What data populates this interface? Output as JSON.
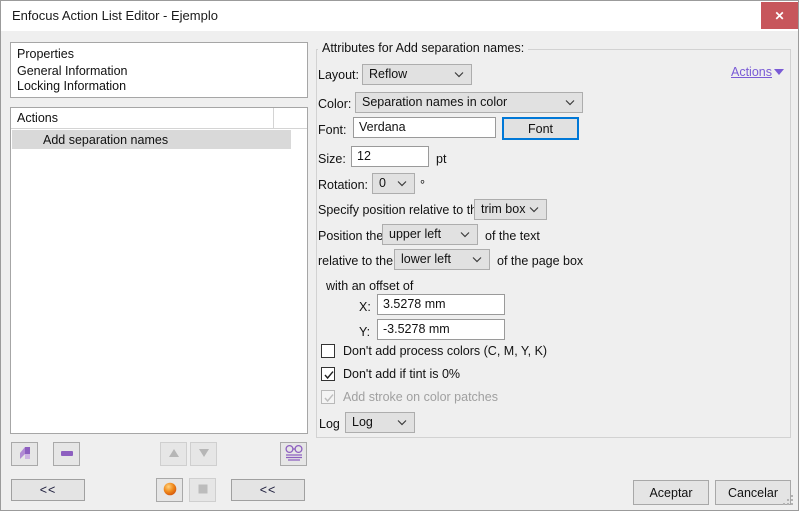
{
  "window": {
    "title": "Enfocus Action List Editor - Ejemplo",
    "close_label": "✕"
  },
  "properties_panel": {
    "items": [
      {
        "label": "Properties"
      },
      {
        "label": "General Information"
      },
      {
        "label": "Locking Information"
      }
    ]
  },
  "actions_panel": {
    "header": "Actions",
    "rows": [
      {
        "label": "Add separation names"
      }
    ]
  },
  "attributes": {
    "legend": "Attributes for Add separation names:",
    "actions_link": "Actions",
    "layout": {
      "label": "Layout:",
      "value": "Reflow"
    },
    "color": {
      "label": "Color:",
      "value": "Separation names in color"
    },
    "font": {
      "label": "Font:",
      "value": "Verdana",
      "button": "Font"
    },
    "size": {
      "label": "Size:",
      "value": "12",
      "unit": "pt"
    },
    "rotation": {
      "label": "Rotation:",
      "value": "0",
      "unit": "°"
    },
    "specify_position": {
      "label": "Specify position relative to the",
      "value": "trim box"
    },
    "position_the": {
      "label": "Position the",
      "value": "upper left",
      "suffix": "of the text"
    },
    "relative_to": {
      "label": "relative to the",
      "value": "lower left",
      "suffix": "of the page box"
    },
    "offset": {
      "label": "with an offset of",
      "x_label": "X:",
      "x_value": "3.5278 mm",
      "y_label": "Y:",
      "y_value": "-3.5278 mm"
    },
    "checkboxes": [
      {
        "label": "Don't add process colors (C, M, Y, K)",
        "checked": false,
        "enabled": true
      },
      {
        "label": "Don't add if tint is 0%",
        "checked": true,
        "enabled": true
      },
      {
        "label": "Add stroke on color patches",
        "checked": true,
        "enabled": false
      }
    ],
    "log": {
      "label": "Log",
      "value": "Log"
    }
  },
  "toolbar": {
    "add_action": "add-action-icon",
    "remove_action": "remove-action-icon",
    "move_up": "arrow-up-icon",
    "move_down": "arrow-down-icon",
    "preview": "glasses-icon",
    "sphere": "sphere-icon",
    "square": "square-icon",
    "collapse_left": "<<",
    "collapse_right": "<<"
  },
  "footer": {
    "accept": "Aceptar",
    "cancel": "Cancelar"
  },
  "colors": {
    "accent_purple": "#7a5bd6",
    "focus_blue": "#0078d7",
    "close_red": "#c7565b",
    "sphere_orange": "#ef7b1a",
    "dialog_bg": "#efefef"
  }
}
